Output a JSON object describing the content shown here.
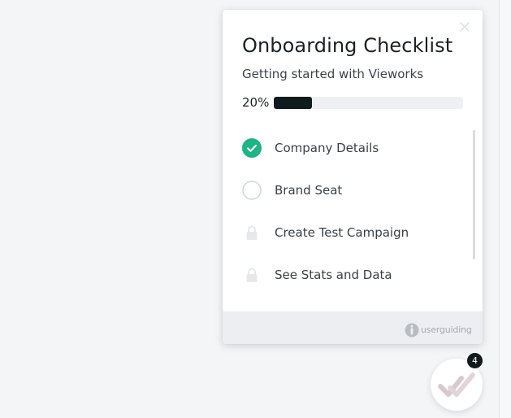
{
  "checklist": {
    "title": "Onboarding Checklist",
    "subtitle": "Getting started with Vieworks",
    "progress": {
      "label": "20%",
      "value": 0.2
    },
    "tasks": [
      {
        "label": "Company Details",
        "status": "completed",
        "icon": "check-circle-icon"
      },
      {
        "label": "Brand Seat",
        "status": "open",
        "icon": "empty-circle-icon"
      },
      {
        "label": "Create Test Campaign",
        "status": "locked",
        "icon": "lock-icon"
      },
      {
        "label": "See Stats and Data",
        "status": "locked",
        "icon": "lock-icon"
      }
    ],
    "footer": {
      "brand": "userguiding"
    }
  },
  "launcher": {
    "badge_count": "4",
    "icon": "double-check-icon"
  },
  "colors": {
    "accent_green": "#20b386",
    "progress_fill": "#0f1b1c",
    "badge": "#111a1c"
  }
}
